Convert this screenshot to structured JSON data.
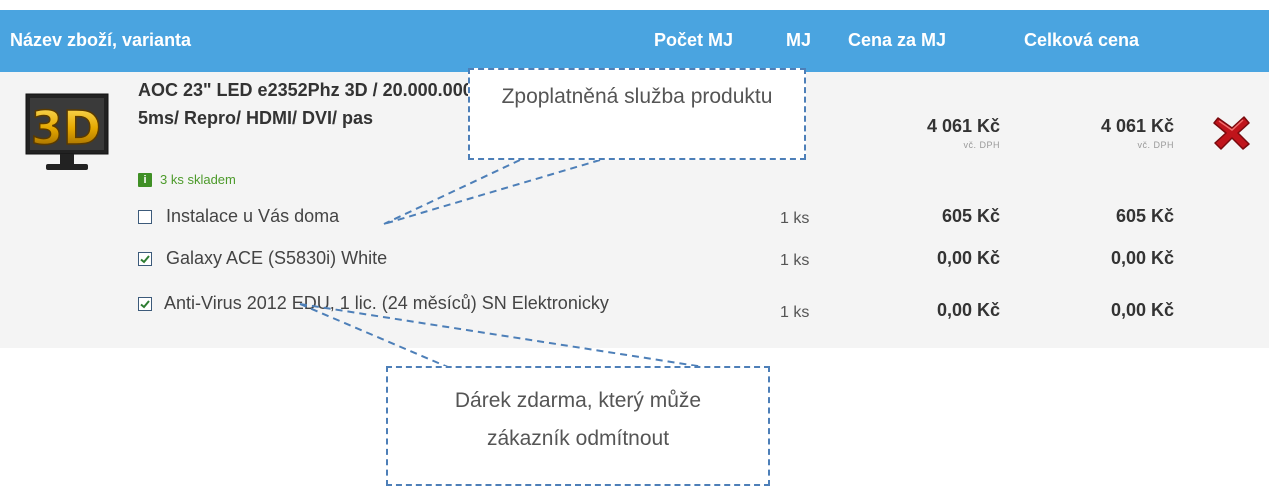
{
  "header": {
    "name": "Název zboží, varianta",
    "count": "Počet MJ",
    "unit": "MJ",
    "unit_price": "Cena za MJ",
    "total": "Celková cena"
  },
  "product": {
    "name": "AOC 23\" LED e2352Phz 3D / 20.000.000:1/ 5ms/ Repro/ HDMI/ DVI/ pas",
    "stock": "3 ks skladem",
    "stock_icon": "info-icon",
    "thumb_label": "3D",
    "unit_price": "4 061 Kč",
    "unit_price_note": "vč. DPH",
    "total": "4 061 Kč",
    "total_note": "vč. DPH"
  },
  "services": [
    {
      "label": "Instalace u Vás doma",
      "checked": false,
      "qty": "1 ks",
      "unit_price": "605 Kč",
      "total": "605 Kč"
    },
    {
      "label": "Galaxy ACE (S5830i) White",
      "checked": true,
      "qty": "1 ks",
      "unit_price": "0,00 Kč",
      "total": "0,00 Kč"
    },
    {
      "label": "Anti-Virus 2012 EDU, 1 lic. (24 měsíců) SN Elektronicky",
      "checked": true,
      "qty": "1 ks",
      "unit_price": "0,00 Kč",
      "total": "0,00 Kč"
    }
  ],
  "callouts": {
    "paid_service": "Zpoplatněná služba produktu",
    "free_gift": "Dárek zdarma, který může zákazník odmítnout"
  },
  "colors": {
    "header": "#4aa4e0",
    "stock": "#4c9a2a",
    "remove": "#c0141b",
    "callout_border": "#4d7fb8"
  }
}
